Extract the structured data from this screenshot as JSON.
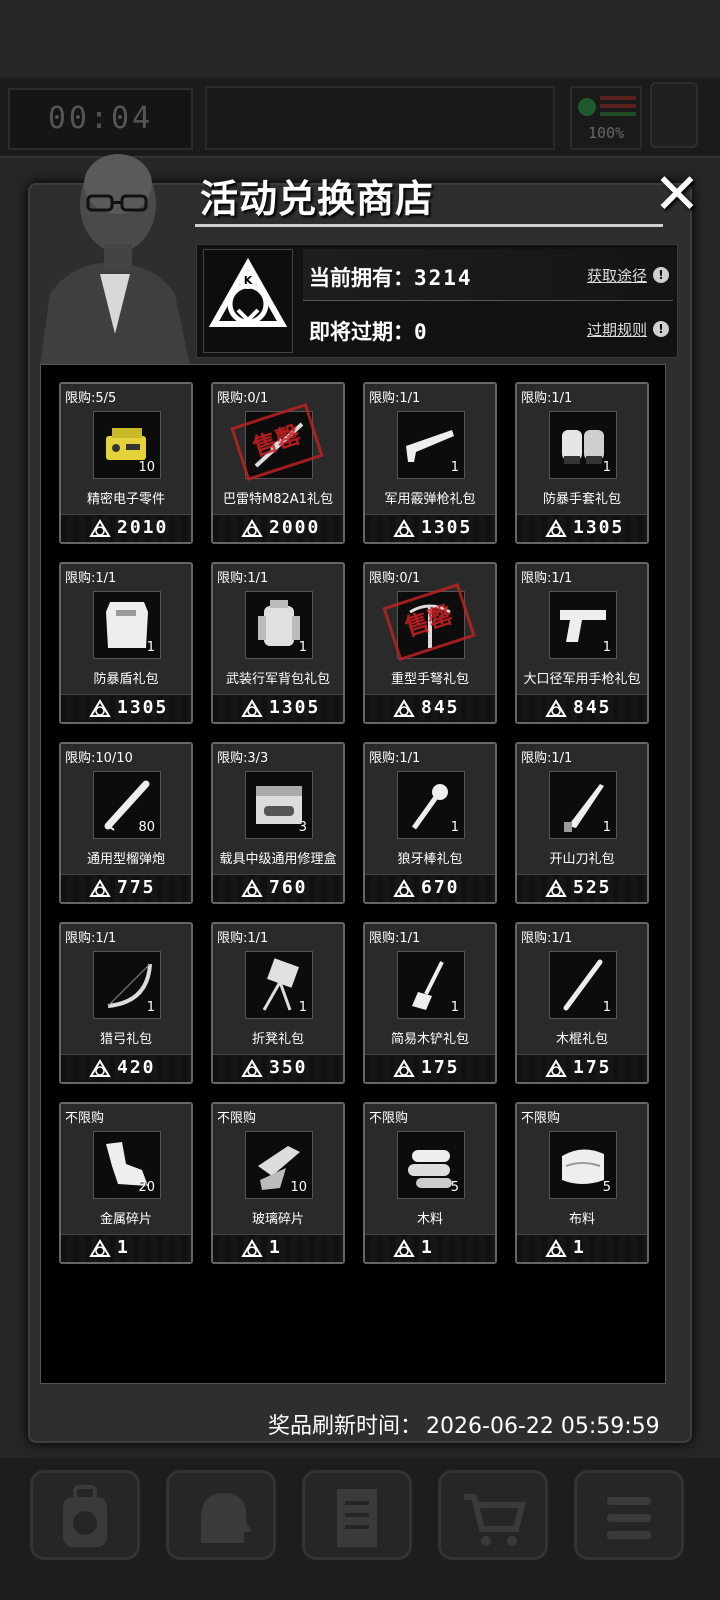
{
  "hud": {
    "timer": "00:04",
    "battery_percent": "100%"
  },
  "shop": {
    "title": "活动兑换商店",
    "owned_label": "当前拥有：",
    "owned_value": "3214",
    "expiring_label": "即将过期：",
    "expiring_value": "0",
    "obtain_link": "获取途径",
    "expire_rules_link": "过期规则",
    "refresh_label": "奖品刷新时间：",
    "refresh_time": "2026-06-22 05:59:59",
    "sold_out_stamp": "售罄"
  },
  "items": [
    {
      "limit": "限购:5/5",
      "name": "精密电子零件",
      "qty": "10",
      "price": "2010",
      "icon": "electronics-icon",
      "sold_out": false
    },
    {
      "limit": "限购:0/1",
      "name": "巴雷特M82A1礼包",
      "qty": "",
      "price": "2000",
      "icon": "sniper-rifle-icon",
      "sold_out": true
    },
    {
      "limit": "限购:1/1",
      "name": "军用霰弹枪礼包",
      "qty": "1",
      "price": "1305",
      "icon": "shotgun-icon",
      "sold_out": false
    },
    {
      "limit": "限购:1/1",
      "name": "防暴手套礼包",
      "qty": "1",
      "price": "1305",
      "icon": "gloves-icon",
      "sold_out": false
    },
    {
      "limit": "限购:1/1",
      "name": "防暴盾礼包",
      "qty": "1",
      "price": "1305",
      "icon": "riot-shield-icon",
      "sold_out": false
    },
    {
      "limit": "限购:1/1",
      "name": "武装行军背包礼包",
      "qty": "1",
      "price": "1305",
      "icon": "backpack-icon",
      "sold_out": false
    },
    {
      "limit": "限购:0/1",
      "name": "重型手弩礼包",
      "qty": "",
      "price": "845",
      "icon": "crossbow-icon",
      "sold_out": true
    },
    {
      "limit": "限购:1/1",
      "name": "大口径军用手枪礼包",
      "qty": "1",
      "price": "845",
      "icon": "pistol-icon",
      "sold_out": false
    },
    {
      "limit": "限购:10/10",
      "name": "通用型榴弹炮",
      "qty": "80",
      "price": "775",
      "icon": "grenade-shell-icon",
      "sold_out": false
    },
    {
      "limit": "限购:3/3",
      "name": "载具中级通用修理盒",
      "qty": "3",
      "price": "760",
      "icon": "repair-box-icon",
      "sold_out": false
    },
    {
      "limit": "限购:1/1",
      "name": "狼牙棒礼包",
      "qty": "1",
      "price": "670",
      "icon": "spiked-club-icon",
      "sold_out": false
    },
    {
      "limit": "限购:1/1",
      "name": "开山刀礼包",
      "qty": "1",
      "price": "525",
      "icon": "machete-icon",
      "sold_out": false
    },
    {
      "limit": "限购:1/1",
      "name": "猎弓礼包",
      "qty": "1",
      "price": "420",
      "icon": "bow-icon",
      "sold_out": false
    },
    {
      "limit": "限购:1/1",
      "name": "折凳礼包",
      "qty": "1",
      "price": "350",
      "icon": "folding-chair-icon",
      "sold_out": false
    },
    {
      "limit": "限购:1/1",
      "name": "简易木铲礼包",
      "qty": "1",
      "price": "175",
      "icon": "wooden-shovel-icon",
      "sold_out": false
    },
    {
      "limit": "限购:1/1",
      "name": "木棍礼包",
      "qty": "1",
      "price": "175",
      "icon": "wooden-stick-icon",
      "sold_out": false
    },
    {
      "limit": "不限购",
      "name": "金属碎片",
      "qty": "20",
      "price": "1",
      "icon": "metal-scrap-icon",
      "sold_out": false
    },
    {
      "limit": "不限购",
      "name": "玻璃碎片",
      "qty": "10",
      "price": "1",
      "icon": "glass-shard-icon",
      "sold_out": false
    },
    {
      "limit": "不限购",
      "name": "木料",
      "qty": "5",
      "price": "1",
      "icon": "wood-logs-icon",
      "sold_out": false
    },
    {
      "limit": "不限购",
      "name": "布料",
      "qty": "5",
      "price": "1",
      "icon": "cloth-icon",
      "sold_out": false
    }
  ]
}
